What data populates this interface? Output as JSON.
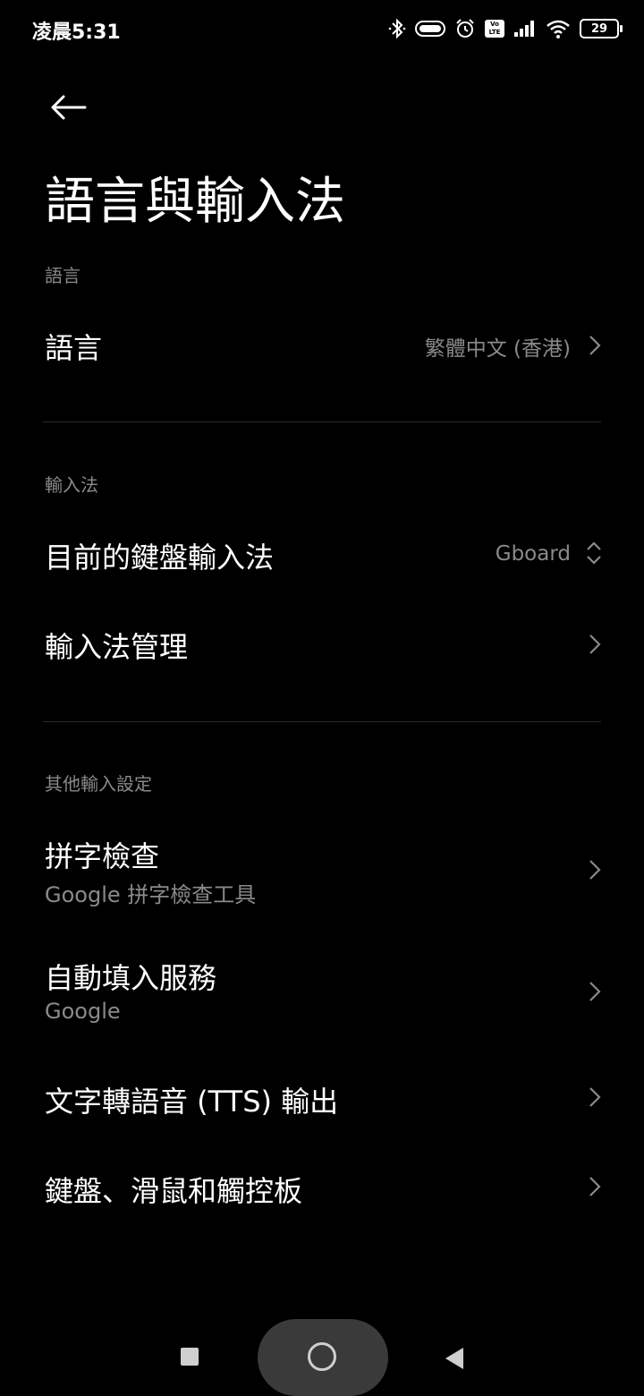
{
  "status_bar": {
    "time": "凌晨5:31",
    "battery": "29",
    "network_badge": "Vo LTE",
    "icons": [
      "bluetooth-icon",
      "toggle-icon",
      "alarm-icon",
      "volte-icon",
      "signal-icon",
      "wifi-icon",
      "battery-icon"
    ]
  },
  "header": {
    "title": "語言與輸入法"
  },
  "sections": {
    "language": {
      "header": "語言",
      "items": [
        {
          "label": "語言",
          "value": "繁體中文 (香港)"
        }
      ]
    },
    "input": {
      "header": "輸入法",
      "items": [
        {
          "label": "目前的鍵盤輸入法",
          "value": "Gboard"
        },
        {
          "label": "輸入法管理"
        }
      ]
    },
    "other": {
      "header": "其他輸入設定",
      "items": [
        {
          "label": "拼字檢查",
          "subtitle": "Google 拼字檢查工具"
        },
        {
          "label": "自動填入服務",
          "subtitle": "Google"
        },
        {
          "label": "文字轉語音 (TTS) 輸出"
        },
        {
          "label": "鍵盤、滑鼠和觸控板"
        }
      ]
    }
  },
  "nav_bar": {
    "icons": [
      "recents-square-icon",
      "home-circle-icon",
      "back-triangle-icon"
    ]
  }
}
